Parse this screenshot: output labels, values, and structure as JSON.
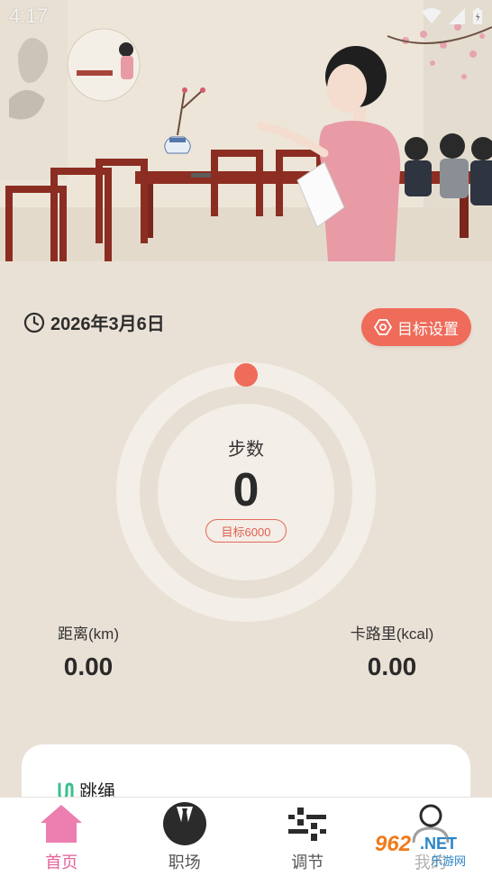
{
  "status_bar": {
    "time": "4:17"
  },
  "header": {
    "date": "2026年3月6日",
    "goal_button_label": "目标设置"
  },
  "steps": {
    "label": "步数",
    "value": "0",
    "goal": "目标6000",
    "progress": 0
  },
  "stats": {
    "distance": {
      "label": "距离(km)",
      "value": "0.00"
    },
    "calories": {
      "label": "卡路里(kcal)",
      "value": "0.00"
    }
  },
  "card": {
    "title": "跳绳"
  },
  "nav": [
    {
      "label": "首页",
      "icon": "home-icon",
      "active": true
    },
    {
      "label": "职场",
      "icon": "tie-icon",
      "active": false
    },
    {
      "label": "调节",
      "icon": "sliders-icon",
      "active": false
    },
    {
      "label": "我的",
      "icon": "user-icon",
      "active": false
    }
  ],
  "watermark": {
    "text": "962.NET",
    "subtext": "乐游网"
  },
  "colors": {
    "accent": "#ef6b5a",
    "background": "#eae1d6",
    "active_nav": "#e5609a"
  }
}
